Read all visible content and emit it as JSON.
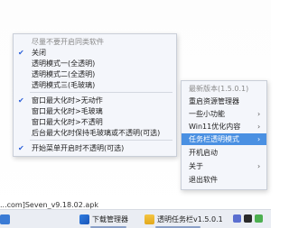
{
  "background": {
    "filename": "...com]Seven_v9.18.02.apk"
  },
  "left_menu": {
    "items": [
      {
        "label": "尽量不要开启同类软件",
        "checked": false,
        "disabled": true
      },
      {
        "label": "关闭",
        "checked": true,
        "disabled": false
      },
      {
        "label": "透明模式一(全透明)",
        "checked": false,
        "disabled": false
      },
      {
        "label": "透明模式二(全透明)",
        "checked": false,
        "disabled": false
      },
      {
        "label": "透明模式三(毛玻璃)",
        "checked": false,
        "disabled": false
      },
      {
        "label": "窗口最大化时>无动作",
        "checked": true,
        "disabled": false
      },
      {
        "label": "窗口最大化时>毛玻璃",
        "checked": false,
        "disabled": false
      },
      {
        "label": "窗口最大化时>不透明",
        "checked": false,
        "disabled": false
      },
      {
        "label": "后台最大化时保持毛玻璃或不透明(可选)",
        "checked": false,
        "disabled": false
      },
      {
        "label": "开始菜单开启时不透明(可选)",
        "checked": true,
        "disabled": false
      }
    ]
  },
  "right_menu": {
    "items": [
      {
        "label": "最新版本(1.5.0.1)",
        "submenu": false,
        "disabled": true
      },
      {
        "label": "重启资源管理器",
        "submenu": false,
        "disabled": false
      },
      {
        "label": "一些小功能",
        "submenu": true,
        "disabled": false
      },
      {
        "label": "Win11优化内容",
        "submenu": true,
        "disabled": false
      },
      {
        "label": "任务栏透明模式",
        "submenu": true,
        "disabled": false,
        "active": true
      },
      {
        "label": "开机启动",
        "submenu": false,
        "disabled": false
      },
      {
        "label": "关于",
        "submenu": true,
        "disabled": false
      },
      {
        "label": "退出软件",
        "submenu": false,
        "disabled": false
      }
    ]
  },
  "taskbar": {
    "items": [
      {
        "label": "下载管理器",
        "icon": "download-manager-icon"
      },
      {
        "label": "透明任务栏v1.5.0.1",
        "icon": "folder-icon"
      }
    ]
  },
  "colors": {
    "highlight": "#4a90e2",
    "check": "#2b5fd9",
    "menu_bg": "#f4f6fb"
  }
}
